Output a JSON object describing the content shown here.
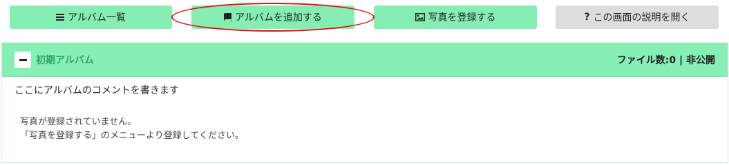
{
  "toolbar": {
    "list_label": "アルバム一覧",
    "add_label": "アルバムを追加する",
    "photo_label": "写真を登録する",
    "help_label": "この画面の説明を開く"
  },
  "icons": {
    "list": "list-icon",
    "add": "book-icon",
    "photo": "image-icon",
    "help": "question-icon"
  },
  "colors": {
    "button_green": "#86eeb3",
    "button_gray": "#dddddd",
    "header_green": "#86efb5",
    "title_green": "#2fa468",
    "highlight_red": "#e01010"
  },
  "album": {
    "title": "初期アルバム",
    "file_count_label": "ファイル数:0",
    "separator": "|",
    "visibility": "非公開",
    "comment": "ここにアルバムのコメントを書きます",
    "empty_line1": "写真が登録されていません。",
    "empty_line2": "「写真を登録する」のメニューより登録してください。"
  }
}
